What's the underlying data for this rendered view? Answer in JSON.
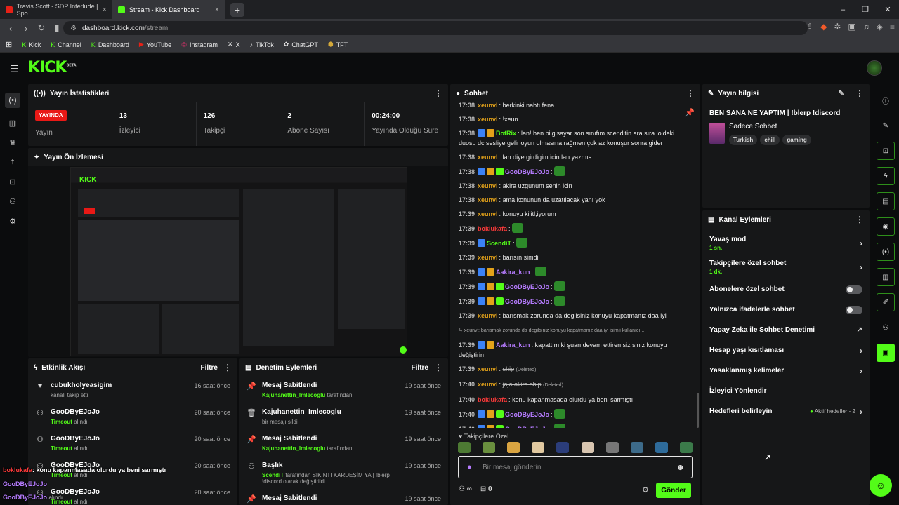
{
  "browser": {
    "tabs": [
      {
        "title": "Travis Scott - SDP Interlude | Spo",
        "icon": "youtube-icon"
      },
      {
        "title": "Stream - Kick Dashboard",
        "icon": "kick-icon"
      }
    ],
    "url_domain": "dashboard.kick.com",
    "url_path": "/stream",
    "bookmarks": [
      "Kick",
      "Channel",
      "Dashboard",
      "YouTube",
      "Instagram",
      "X",
      "TikTok",
      "ChatGPT",
      "TFT"
    ]
  },
  "app": {
    "logo": "KICK",
    "logo_sup": "BETA",
    "accent": "#53fc18"
  },
  "stats": {
    "title": "Yayın İstatistikleri",
    "live_badge": "YAYINDA",
    "items": [
      {
        "value": "",
        "label": "Yayın"
      },
      {
        "value": "13",
        "label": "İzleyici"
      },
      {
        "value": "126",
        "label": "Takipçi"
      },
      {
        "value": "2",
        "label": "Abone Sayısı"
      },
      {
        "value": "00:24:00",
        "label": "Yayında Olduğu Süre"
      }
    ]
  },
  "preview": {
    "title": "Yayın Ön İzlemesi"
  },
  "activity": {
    "title": "Etkinlik Akışı",
    "filter": "Filtre",
    "items": [
      {
        "name": "cubukholyeasigim",
        "sub": "kanalı takip etti",
        "sub_hl": "",
        "time": "16 saat önce",
        "icon": "heart-icon"
      },
      {
        "name": "GooDByEJoJo",
        "sub": " alındı",
        "sub_hl": "Timeout",
        "time": "20 saat önce",
        "icon": "moderation-icon"
      },
      {
        "name": "GooDByEJoJo",
        "sub": " alındı",
        "sub_hl": "Timeout",
        "time": "20 saat önce",
        "icon": "moderation-icon"
      },
      {
        "name": "GooDByEJoJo",
        "sub": " alındı",
        "sub_hl": "Timeout",
        "time": "20 saat önce",
        "icon": "moderation-icon"
      },
      {
        "name": "GooDByEJoJo",
        "sub": " alındı",
        "sub_hl": "Timeout",
        "time": "20 saat önce",
        "icon": "moderation-icon"
      }
    ]
  },
  "modlog": {
    "title": "Denetim Eylemleri",
    "filter": "Filtre",
    "items": [
      {
        "name": "Mesaj Sabitlendi",
        "hl": "Kajuhanettin_Imlecoglu",
        "sub": " tarafından",
        "time": "19 saat önce",
        "icon": "pin-icon"
      },
      {
        "name": "Kajuhanettin_Imlecoglu",
        "hl": "",
        "sub": "bir mesajı sildi",
        "time": "19 saat önce",
        "icon": "trash-icon"
      },
      {
        "name": "Mesaj Sabitlendi",
        "hl": "Kajuhanettin_Imlecoglu",
        "sub": " tarafından",
        "time": "19 saat önce",
        "icon": "pin-icon"
      },
      {
        "name": "Başlık",
        "hl": "ScendiT",
        "sub": " tarafından SIKINTI KARDEŞİM YA | !blerp !discord olarak değiştirildi",
        "time": "19 saat önce",
        "icon": "title-edit-icon"
      },
      {
        "name": "Mesaj Sabitlendi",
        "hl": "",
        "sub": "",
        "time": "19 saat önce",
        "icon": "pin-icon"
      }
    ]
  },
  "chat": {
    "title": "Sohbet",
    "placeholder": "Bir mesaj gönderin",
    "followers_only": "Takipçilere Özel",
    "send": "Gönder",
    "points": "0",
    "messages": [
      {
        "t": "17:38",
        "u": "xeunvl",
        "c": "#e3a21a",
        "m": "berkinki nabtı fena",
        "b": 0
      },
      {
        "t": "17:38",
        "u": "xeunvl",
        "c": "#e3a21a",
        "m": "!xeun",
        "b": 0
      },
      {
        "t": "17:38",
        "u": "BotRix",
        "c": "#53fc18",
        "m": "lan! ben bilgisayar son sınıfım scenditin ara sıra loldeki duosu dc sesliye gelir oyun olmasına rağmen çok az konuşur sonra gider",
        "b": 2
      },
      {
        "t": "17:38",
        "u": "xeunvl",
        "c": "#e3a21a",
        "m": "lan diye girdigim icin lan yazmıs",
        "b": 0
      },
      {
        "t": "17:38",
        "u": "GooDByEJoJo",
        "c": "#b67cff",
        "m": "",
        "b": 3,
        "e": true
      },
      {
        "t": "17:38",
        "u": "xeunvl",
        "c": "#e3a21a",
        "m": "akira uzgunum senin icin",
        "b": 0
      },
      {
        "t": "17:38",
        "u": "xeunvl",
        "c": "#e3a21a",
        "m": "ama konunun da uzatılacak yanı yok",
        "b": 0
      },
      {
        "t": "17:39",
        "u": "xeunvl",
        "c": "#e3a21a",
        "m": "konuyu kilitl,iyorum",
        "b": 0
      },
      {
        "t": "17:39",
        "u": "boklukafa",
        "c": "#ff3a3a",
        "m": "",
        "b": 0,
        "e": true
      },
      {
        "t": "17:39",
        "u": "ScendiT",
        "c": "#53fc18",
        "m": "",
        "b": 1,
        "e": true
      },
      {
        "t": "17:39",
        "u": "xeunvl",
        "c": "#e3a21a",
        "m": "barısın simdi",
        "b": 0
      },
      {
        "t": "17:39",
        "u": "Aakira_kun",
        "c": "#b67cff",
        "m": "",
        "b": 2,
        "e": true
      },
      {
        "t": "17:39",
        "u": "GooDByEJoJo",
        "c": "#b67cff",
        "m": "",
        "b": 3,
        "e": true
      },
      {
        "t": "17:39",
        "u": "GooDByEJoJo",
        "c": "#b67cff",
        "m": "",
        "b": 3,
        "e": true
      },
      {
        "t": "17:39",
        "u": "xeunvl",
        "c": "#e3a21a",
        "m": "barısmak zorunda da degilsiniz konuyu kapatmanız daa iyi",
        "b": 0
      },
      {
        "t": "",
        "u": "",
        "c": "#aaa",
        "m": "↳ xeunvl: barısmak zorunda da degilsiniz konuyu kapatmanız daa iyi isimli kullanıcı...",
        "b": 0,
        "reply": true
      },
      {
        "t": "17:39",
        "u": "Aakira_kun",
        "c": "#b67cff",
        "m": "kapattım ki şuan devam ettiren siz siniz konuyu değiştirin",
        "b": 2
      },
      {
        "t": "17:39",
        "u": "xeunvl",
        "c": "#e3a21a",
        "m": "ship",
        "b": 0,
        "del": true
      },
      {
        "t": "17:40",
        "u": "xeunvl",
        "c": "#e3a21a",
        "m": "jojo akira ship",
        "b": 0,
        "del": true
      },
      {
        "t": "17:40",
        "u": "boklukafa",
        "c": "#ff3a3a",
        "m": "konu kapanmasada olurdu ya beni sarmıştı",
        "b": 0
      },
      {
        "t": "17:40",
        "u": "GooDByEJoJo",
        "c": "#b67cff",
        "m": "",
        "b": 3,
        "e": true
      },
      {
        "t": "17:40",
        "u": "GooDByEJoJo",
        "c": "#b67cff",
        "m": "",
        "b": 3,
        "e": true
      }
    ],
    "deleted_label": "(Deleted)"
  },
  "info": {
    "title": "Yayın bilgisi",
    "stream_title": "BEN SANA NE YAPTIM | !blerp !discord",
    "category": "Sadece Sohbet",
    "tags": [
      "Turkish",
      "chill",
      "gaming"
    ]
  },
  "channel_actions": {
    "title": "Kanal Eylemleri",
    "items": [
      {
        "label": "Yavaş mod",
        "sub": "1 sn.",
        "ctrl": "chevron"
      },
      {
        "label": "Takipçilere özel sohbet",
        "sub": "1 dk.",
        "ctrl": "chevron"
      },
      {
        "label": "Abonelere özel sohbet",
        "sub": "",
        "ctrl": "toggle"
      },
      {
        "label": "Yalnızca ifadelerle sohbet",
        "sub": "",
        "ctrl": "toggle"
      },
      {
        "label": "Yapay Zeka ile Sohbet Denetimi",
        "sub": "",
        "ctrl": "external"
      },
      {
        "label": "Hesap yaşı kısıtlaması",
        "sub": "",
        "ctrl": "chevron"
      },
      {
        "label": "Yasaklanmış kelimeler",
        "sub": "",
        "ctrl": "chevron"
      },
      {
        "label": "İzleyici Yönlendir",
        "sub": "",
        "ctrl": "none"
      },
      {
        "label": "Hedefleri belirleyin",
        "sub": "",
        "ctrl": "chevron",
        "extra": "Aktif hedefler - 2"
      }
    ]
  },
  "overlay": {
    "user1": "boklukafa",
    "msg1": ": konu kapanmasada olurdu ya beni sarmıştı",
    "user2": "GooDByEJoJo",
    "user3": "GooDByEJoJo",
    "tail": "alındı"
  }
}
